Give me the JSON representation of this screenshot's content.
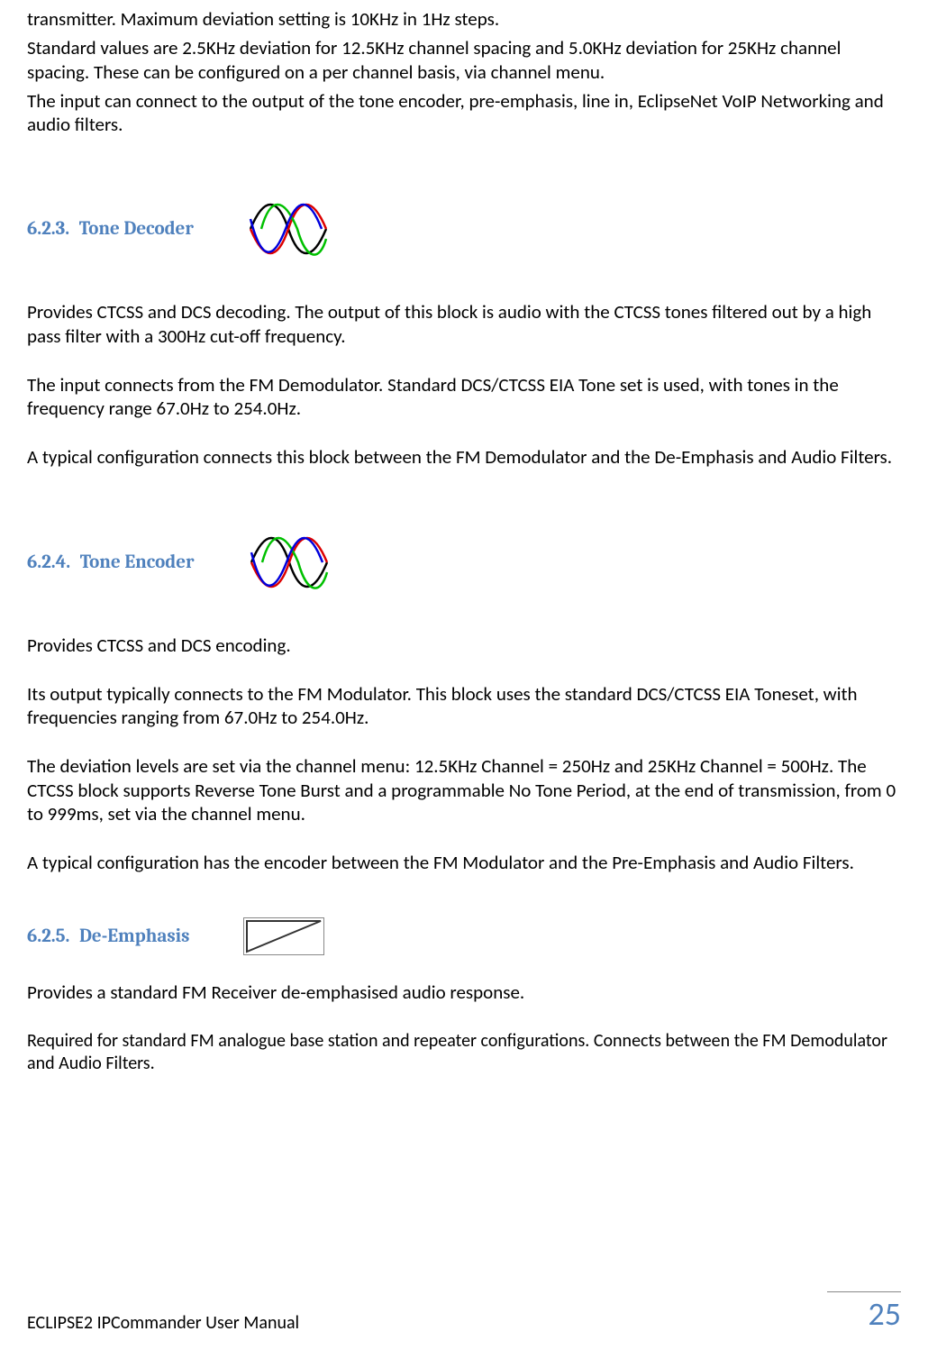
{
  "paragraphs": {
    "intro_p1": "transmitter. Maximum deviation setting is 10KHz in 1Hz steps.",
    "intro_p2": "Standard  values are 2.5KHz deviation for 12.5KHz channel spacing and 5.0KHz deviation for 25KHz channel spacing.  These can be configured on a per channel basis, via channel menu.",
    "intro_p3": "The input can connect to the output of the tone encoder, pre-emphasis, line in, EclipseNet VoIP Networking and audio filters."
  },
  "sections": [
    {
      "number": "6.2.3.",
      "title": "Tone Decoder",
      "icon": "sine-icon",
      "paras": [
        "Provides CTCSS and DCS decoding.  The output of this block is audio with the CTCSS tones filtered out by a high pass filter with a 300Hz cut-off frequency.",
        "The input connects from the FM Demodulator. Standard DCS/CTCSS EIA Tone set is used, with tones in the frequency range 67.0Hz to 254.0Hz.",
        "A typical configuration connects this block between the FM Demodulator and the De-Emphasis and Audio Filters."
      ]
    },
    {
      "number": "6.2.4.",
      "title": "Tone Encoder",
      "icon": "sine-icon",
      "paras": [
        "Provides CTCSS and DCS encoding.",
        "Its output typically connects to the FM Modulator. This block uses the standard DCS/CTCSS EIA Toneset, with frequencies ranging from 67.0Hz to 254.0Hz.",
        "The deviation levels are set via the channel menu: 12.5KHz Channel = 250Hz and 25KHz Channel = 500Hz.  The CTCSS block supports Reverse Tone Burst and a programmable No Tone Period, at the end of transmission, from 0 to 999ms, set via the channel menu.",
        "A typical configuration has the encoder between the FM Modulator and the Pre-Emphasis and Audio Filters."
      ]
    },
    {
      "number": "6.2.5.",
      "title": "De-Emphasis",
      "icon": "triangle-icon",
      "paras": [
        "Provides a standard FM Receiver de-emphasised audio response.",
        "Required for standard FM analogue base station and repeater configurations. Connects between the FM Demodulator and Audio Filters."
      ]
    }
  ],
  "footer": {
    "doc_title": "ECLIPSE2 IPCommander User Manual",
    "page": "25"
  }
}
